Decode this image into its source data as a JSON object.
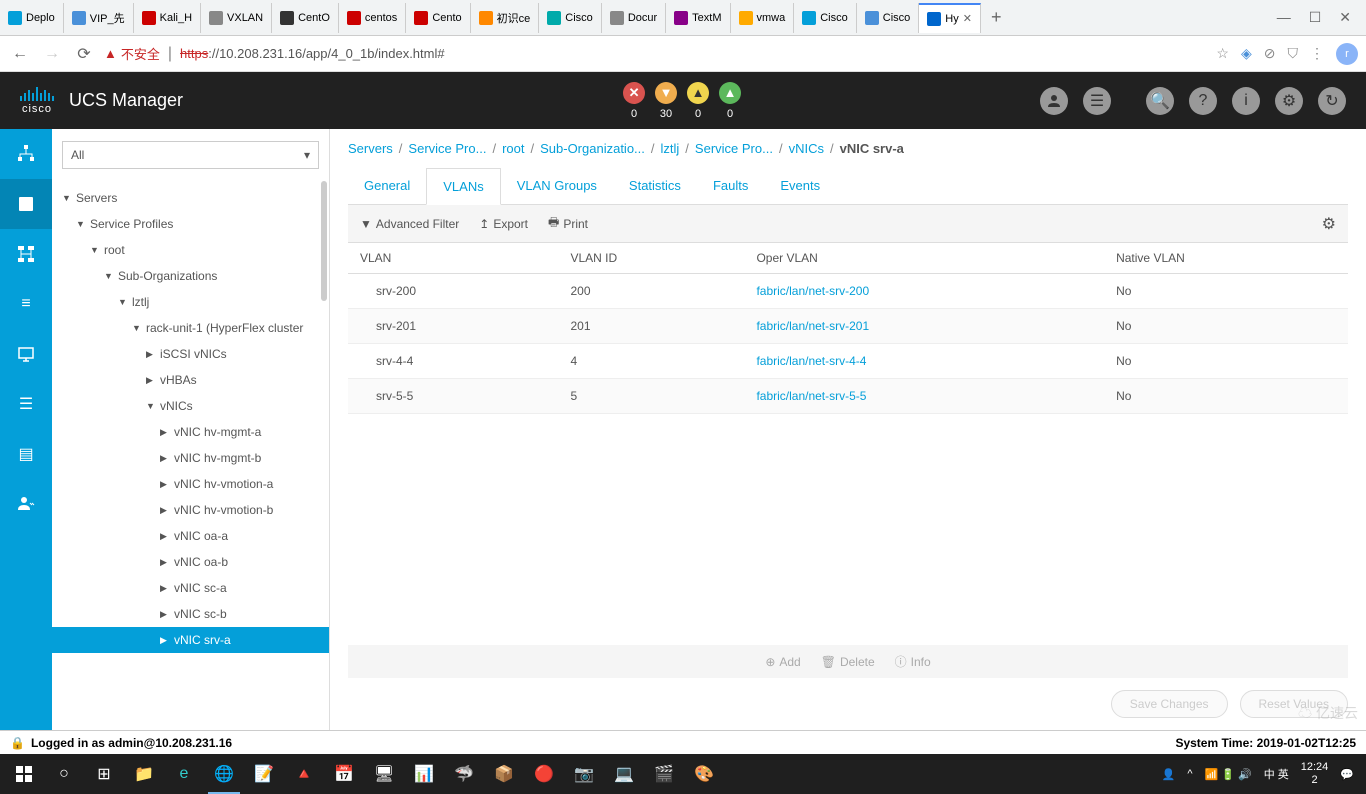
{
  "browser": {
    "tabs": [
      {
        "label": "Deplo",
        "icon": "cisco"
      },
      {
        "label": "VIP_先",
        "icon": "blue"
      },
      {
        "label": "Kali_H",
        "icon": "red-g"
      },
      {
        "label": "VXLAN",
        "icon": "doc"
      },
      {
        "label": "CentO",
        "icon": "linux"
      },
      {
        "label": "centos",
        "icon": "red-c"
      },
      {
        "label": "Cento",
        "icon": "red-c"
      },
      {
        "label": "初识ce",
        "icon": "orange"
      },
      {
        "label": "Cisco",
        "icon": "teal"
      },
      {
        "label": "Docur",
        "icon": "doc"
      },
      {
        "label": "TextM",
        "icon": "purple"
      },
      {
        "label": "vmwa",
        "icon": "vm"
      },
      {
        "label": "Cisco",
        "icon": "cisco"
      },
      {
        "label": "Cisco",
        "icon": "blue"
      },
      {
        "label": "Hy",
        "icon": "tri",
        "active": true
      }
    ],
    "security_label": "不安全",
    "url_prefix": "https",
    "url": "://10.208.231.16/app/4_0_1b/index.html#",
    "profile_letter": "r"
  },
  "header": {
    "app_title": "UCS Manager",
    "logo_text": "cisco",
    "status": [
      {
        "count": "0",
        "color": "red",
        "sym": "✕"
      },
      {
        "count": "30",
        "color": "orange",
        "sym": "▼"
      },
      {
        "count": "0",
        "color": "yellow",
        "sym": "▲"
      },
      {
        "count": "0",
        "color": "green",
        "sym": "▲"
      }
    ]
  },
  "filter_value": "All",
  "tree": [
    {
      "label": "Servers",
      "level": 0,
      "caret": "▼"
    },
    {
      "label": "Service Profiles",
      "level": 1,
      "caret": "▼"
    },
    {
      "label": "root",
      "level": 2,
      "caret": "▼"
    },
    {
      "label": "Sub-Organizations",
      "level": 3,
      "caret": "▼"
    },
    {
      "label": "lztlj",
      "level": 4,
      "caret": "▼"
    },
    {
      "label": "rack-unit-1 (HyperFlex cluster",
      "level": 5,
      "caret": "▼"
    },
    {
      "label": "iSCSI vNICs",
      "level": 6,
      "caret": "▶"
    },
    {
      "label": "vHBAs",
      "level": 6,
      "caret": "▶"
    },
    {
      "label": "vNICs",
      "level": 6,
      "caret": "▼"
    },
    {
      "label": "vNIC hv-mgmt-a",
      "level": 7,
      "caret": "▶"
    },
    {
      "label": "vNIC hv-mgmt-b",
      "level": 7,
      "caret": "▶"
    },
    {
      "label": "vNIC hv-vmotion-a",
      "level": 7,
      "caret": "▶"
    },
    {
      "label": "vNIC hv-vmotion-b",
      "level": 7,
      "caret": "▶"
    },
    {
      "label": "vNIC oa-a",
      "level": 7,
      "caret": "▶"
    },
    {
      "label": "vNIC oa-b",
      "level": 7,
      "caret": "▶"
    },
    {
      "label": "vNIC sc-a",
      "level": 7,
      "caret": "▶"
    },
    {
      "label": "vNIC sc-b",
      "level": 7,
      "caret": "▶"
    },
    {
      "label": "vNIC srv-a",
      "level": 7,
      "caret": "▶",
      "selected": true
    }
  ],
  "breadcrumb": [
    "Servers",
    "Service Pro...",
    "root",
    "Sub-Organizatio...",
    "lztlj",
    "Service Pro...",
    "vNICs"
  ],
  "breadcrumb_current": "vNIC srv-a",
  "tabs": [
    "General",
    "VLANs",
    "VLAN Groups",
    "Statistics",
    "Faults",
    "Events"
  ],
  "active_tab": "VLANs",
  "toolbar": {
    "filter": "Advanced Filter",
    "export": "Export",
    "print": "Print"
  },
  "table": {
    "cols": [
      "VLAN",
      "VLAN ID",
      "Oper VLAN",
      "Native VLAN"
    ],
    "rows": [
      {
        "vlan": "srv-200",
        "id": "200",
        "oper": "fabric/lan/net-srv-200",
        "native": "No"
      },
      {
        "vlan": "srv-201",
        "id": "201",
        "oper": "fabric/lan/net-srv-201",
        "native": "No"
      },
      {
        "vlan": "srv-4-4",
        "id": "4",
        "oper": "fabric/lan/net-srv-4-4",
        "native": "No"
      },
      {
        "vlan": "srv-5-5",
        "id": "5",
        "oper": "fabric/lan/net-srv-5-5",
        "native": "No"
      }
    ]
  },
  "actions": {
    "add": "Add",
    "delete": "Delete",
    "info": "Info"
  },
  "buttons": {
    "save": "Save Changes",
    "reset": "Reset Values"
  },
  "status_bar": {
    "login": "Logged in as admin@10.208.231.16",
    "time": "System Time: 2019-01-02T12:25"
  },
  "taskbar": {
    "time": "12:24",
    "date": "2",
    "lang": "中 英",
    "watermark": "亿速云"
  }
}
